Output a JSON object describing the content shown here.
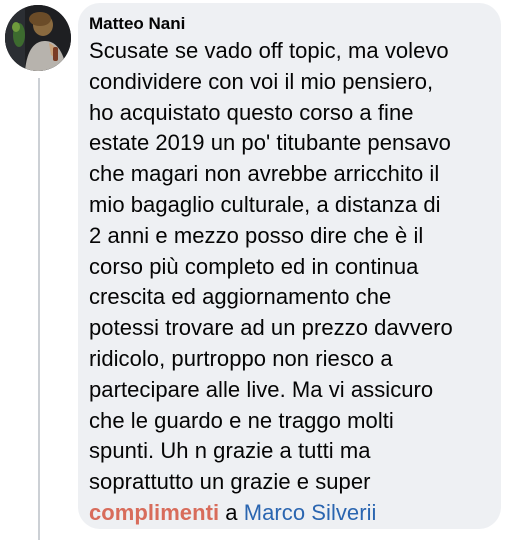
{
  "comment": {
    "author": "Matteo Nani",
    "lines": [
      "Scusate se vado off topic, ma volevo",
      "condividere con voi il mio pensiero,",
      "ho acquistato questo corso a fine",
      "estate 2019 un po' titubante pensavo",
      "che magari non avrebbe arricchito il",
      "mio bagaglio culturale, a distanza di",
      "2 anni e mezzo posso dire che è il",
      "corso più completo ed in continua",
      "crescita ed aggiornamento che",
      "potessi trovare ad un prezzo davvero",
      "ridicolo, purtroppo non riesco a",
      "partecipare alle live. Ma vi assicuro",
      "che le guardo e ne traggo molti",
      "spunti. Uh n grazie a tutti ma",
      "soprattutto un grazie e super"
    ],
    "final_line": {
      "highlight": "complimenti",
      "connector": " a ",
      "mention": "Marco Silverii"
    }
  },
  "colors": {
    "bubble_background": "#eef0f3",
    "highlight": "#d86c5b",
    "mention": "#2a65b0",
    "thread_line": "#ccd0d5"
  }
}
